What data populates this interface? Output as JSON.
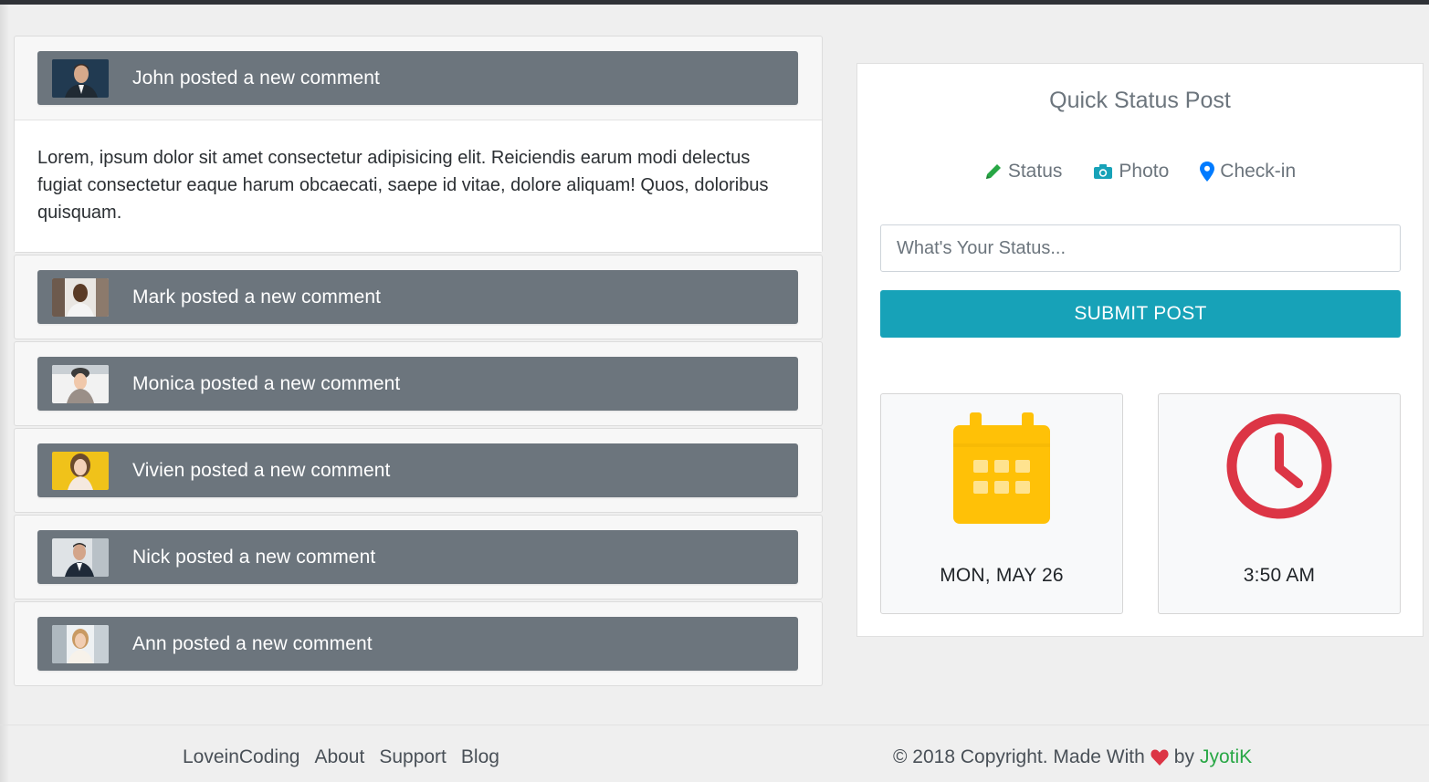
{
  "feed": {
    "items": [
      {
        "author": "John",
        "title": "John posted a new comment",
        "avatar": "john-avatar",
        "body": "Lorem, ipsum dolor sit amet consectetur adipisicing elit. Reiciendis earum modi delectus fugiat consectetur eaque harum obcaecati, saepe id vitae, dolore aliquam! Quos, doloribus quisquam."
      },
      {
        "author": "Mark",
        "title": "Mark posted a new comment",
        "avatar": "mark-avatar"
      },
      {
        "author": "Monica",
        "title": "Monica posted a new comment",
        "avatar": "monica-avatar"
      },
      {
        "author": "Vivien",
        "title": "Vivien posted a new comment",
        "avatar": "vivien-avatar"
      },
      {
        "author": "Nick",
        "title": "Nick posted a new comment",
        "avatar": "nick-avatar"
      },
      {
        "author": "Ann",
        "title": "Ann posted a new comment",
        "avatar": "ann-avatar"
      }
    ]
  },
  "quick_status": {
    "title": "Quick Status Post",
    "tabs": [
      {
        "label": "Status",
        "icon": "pencil-icon",
        "color": "#28a745"
      },
      {
        "label": "Photo",
        "icon": "camera-icon",
        "color": "#17a2b8"
      },
      {
        "label": "Check-in",
        "icon": "map-marker-icon",
        "color": "#007bff"
      }
    ],
    "input_placeholder": "What's Your Status...",
    "submit_label": "SUBMIT POST",
    "date_label": "MON, MAY 26",
    "time_label": "3:50 AM",
    "calendar_color": "#ffc107",
    "clock_color": "#dc3545"
  },
  "footer": {
    "links": [
      "LoveinCoding",
      "About",
      "Support",
      "Blog"
    ],
    "copyright_prefix": "© 2018 Copyright. Made With",
    "by_text": "by",
    "author": "JyotiK",
    "heart_color": "#dc3545",
    "author_color": "#28a745"
  },
  "colors": {
    "accent": "#17a2b8",
    "bar": "#6c757d"
  }
}
